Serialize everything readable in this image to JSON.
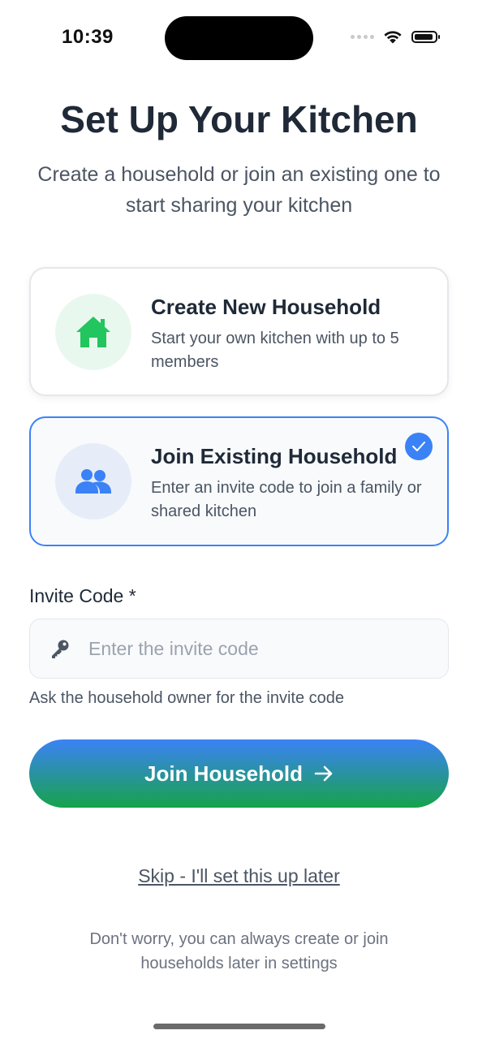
{
  "status_bar": {
    "time": "10:39",
    "signal_icon": "signal-dots-icon",
    "wifi_icon": "wifi-icon",
    "battery_icon": "battery-icon"
  },
  "header": {
    "title": "Set Up Your Kitchen",
    "subtitle": "Create a household or join an existing one to start sharing your kitchen"
  },
  "options": [
    {
      "title": "Create New Household",
      "description": "Start your own kitchen with up to 5 members",
      "icon": "house-icon",
      "selected": false,
      "accent": "#22c55e"
    },
    {
      "title": "Join Existing Household",
      "description": "Enter an invite code to join a family or shared kitchen",
      "icon": "users-icon",
      "selected": true,
      "accent": "#3b82f6"
    }
  ],
  "invite_field": {
    "label": "Invite Code *",
    "placeholder": "Enter the invite code",
    "value": "",
    "icon": "key-icon",
    "helper": "Ask the household owner for the invite code"
  },
  "primary_button": {
    "label": "Join Household",
    "icon": "arrow-right-icon",
    "gradient_from": "#3b82f6",
    "gradient_to": "#16a34a"
  },
  "skip_link": "Skip - I'll set this up later",
  "footer_note": "Don't worry, you can always create or join households later in settings"
}
